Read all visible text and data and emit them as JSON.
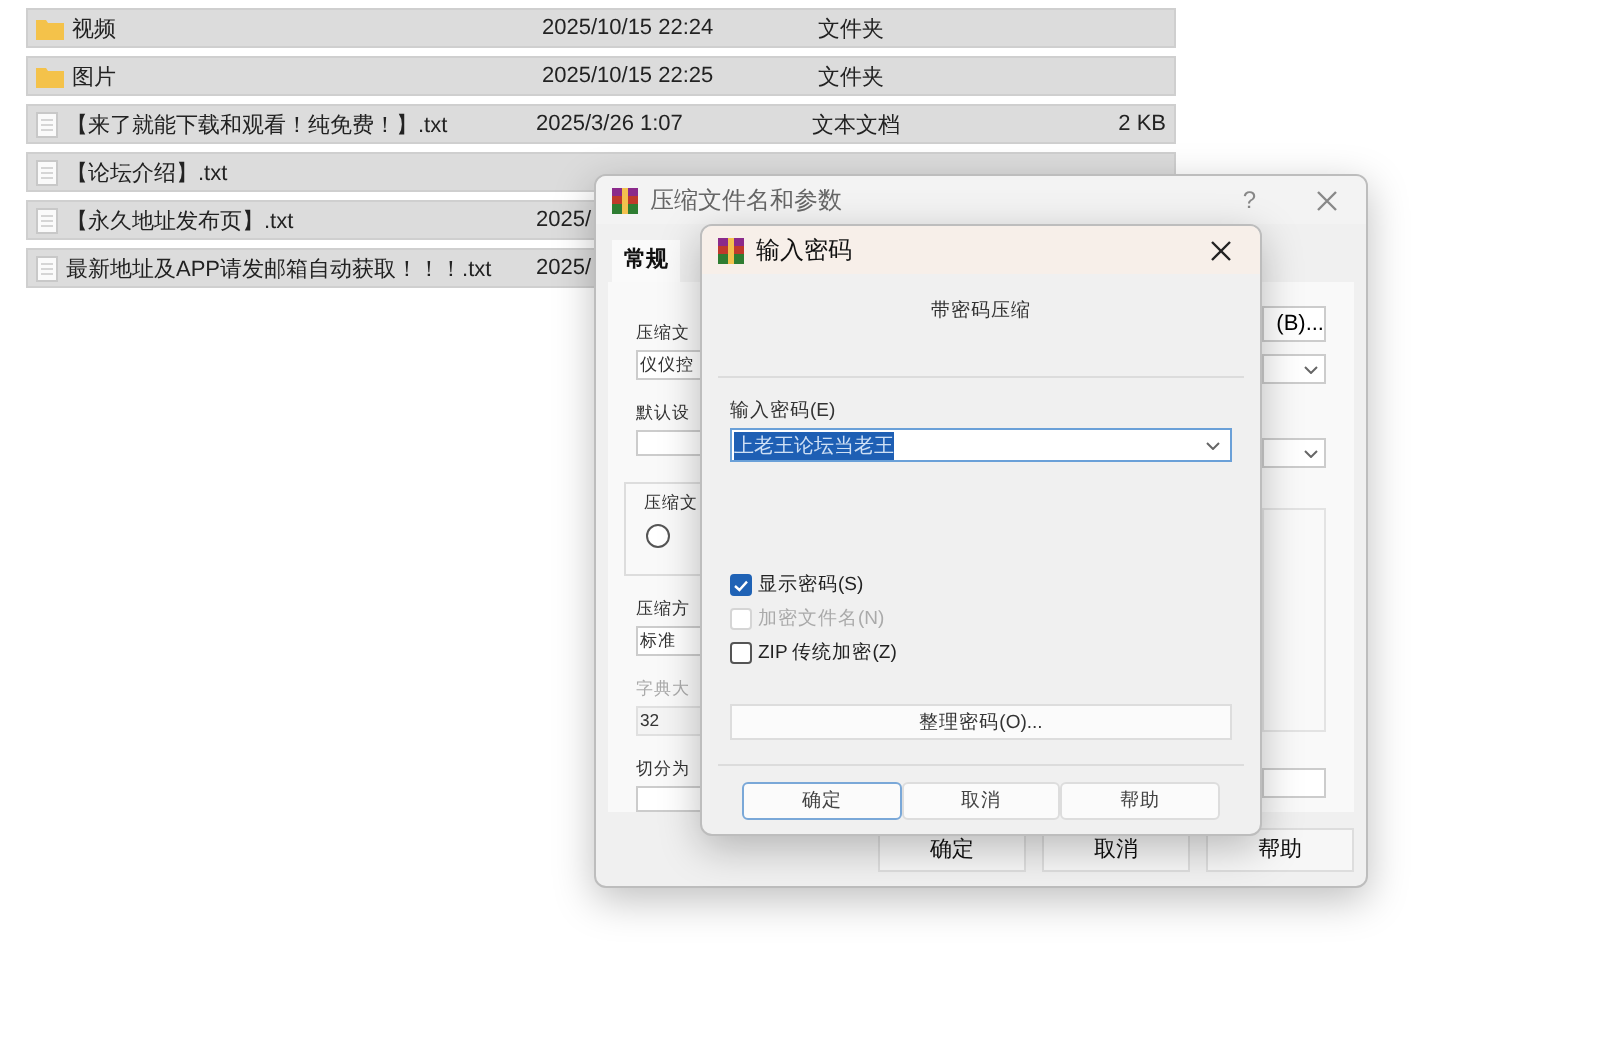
{
  "files": [
    {
      "kind": "folder",
      "name": "视频",
      "date": "2025/10/15 22:24",
      "type": "文件夹"
    },
    {
      "kind": "folder",
      "name": "图片",
      "date": "2025/10/15 22:25",
      "type": "文件夹"
    },
    {
      "kind": "text",
      "name": "【来了就能下载和观看！纯免费！】.txt",
      "date": "2025/3/26 1:07",
      "type": "文本文档",
      "size": "2 KB"
    },
    {
      "kind": "text",
      "name": "【论坛介绍】.txt"
    },
    {
      "kind": "text",
      "name": "【永久地址发布页】.txt",
      "date": "2025/"
    },
    {
      "kind": "text",
      "name": "最新地址及APP请发邮箱自动获取！！！.txt",
      "date": "2025/"
    }
  ],
  "archive_dialog": {
    "title": "压缩文件名和参数",
    "help": "?",
    "tab": {
      "label": "常规",
      "selected": true
    },
    "browse_button": "(B)...",
    "fields": [
      {
        "kind": "label",
        "text": "压缩文"
      },
      {
        "kind": "input",
        "value": "仪仪控"
      },
      {
        "kind": "label",
        "text": "默认设"
      },
      {
        "kind": "input"
      },
      {
        "kind": "group",
        "label": "压缩文",
        "checked": false
      },
      {
        "kind": "label",
        "text": "压缩方"
      },
      {
        "kind": "input",
        "value": "标准"
      },
      {
        "kind": "label",
        "text": "字典大",
        "disabled": true
      },
      {
        "kind": "input",
        "value": "32",
        "disabled": true
      },
      {
        "kind": "label",
        "text": "切分为"
      },
      {
        "kind": "input"
      }
    ],
    "buttons": [
      "确定",
      "取消",
      "帮助"
    ]
  },
  "password_dialog": {
    "title": "输入密码",
    "heading": "带密码压缩",
    "password_label": "输入密码(E)",
    "password_value": "上老王论坛当老王",
    "options": [
      {
        "label": "显示密码(S)",
        "checked": true,
        "disabled": false
      },
      {
        "label": "加密文件名(N)",
        "checked": false,
        "disabled": true
      },
      {
        "label": "ZIP 传统加密(Z)",
        "checked": false,
        "disabled": false
      }
    ],
    "manage_button": "整理密码(O)...",
    "buttons": [
      {
        "label": "确定",
        "default": true
      },
      {
        "label": "取消",
        "default": false
      },
      {
        "label": "帮助",
        "default": false
      }
    ]
  }
}
